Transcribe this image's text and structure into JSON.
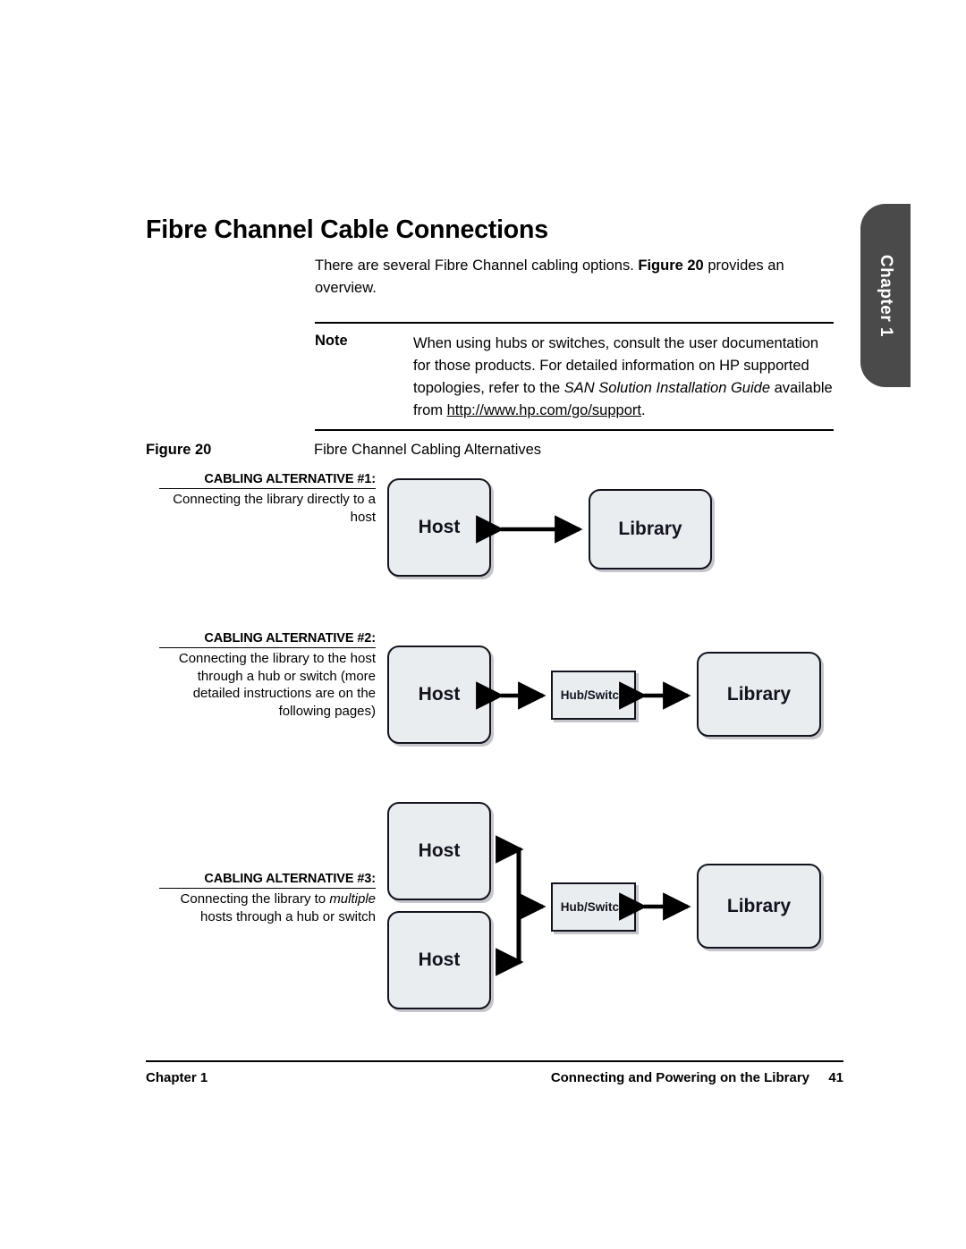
{
  "chapter_tab": {
    "label": "Chapter 1"
  },
  "heading": {
    "title": "Fibre Channel Cable Connections"
  },
  "intro": {
    "text_before": "There are several Fibre Channel cabling options. ",
    "bold_ref": "Figure 20",
    "text_after": " provides an overview."
  },
  "note": {
    "label": "Note",
    "line1": "When using hubs or switches, consult the user documentation for those products. For detailed information on HP supported topologies, refer to the ",
    "italic_title": "SAN Solution Installation Guide",
    "line2": " available from ",
    "url": "http://www.hp.com/go/support",
    "end": "."
  },
  "figure": {
    "number": "Figure 20",
    "title": "Fibre Channel Cabling Alternatives"
  },
  "alternatives": [
    {
      "title": "CABLING ALTERNATIVE #1:",
      "description": "Connecting the library directly to a host",
      "nodes": {
        "host": "Host",
        "library": "Library"
      }
    },
    {
      "title": "CABLING ALTERNATIVE #2:",
      "description": "Connecting the library to the host through a hub or switch (more detailed instructions are on the following pages)",
      "nodes": {
        "host": "Host",
        "hub": "Hub/Switch",
        "library": "Library"
      }
    },
    {
      "title": "CABLING ALTERNATIVE #3:",
      "description_pre": "Connecting the library to ",
      "description_italic": "multiple",
      "description_post": " hosts through a hub or switch",
      "nodes": {
        "host1": "Host",
        "host2": "Host",
        "hub": "Hub/Switch",
        "library": "Library"
      }
    }
  ],
  "footer": {
    "left": "Chapter 1",
    "center": "Connecting and Powering on the Library",
    "page_number": "41"
  },
  "colors": {
    "tab_background": "#4a4a4a",
    "node_fill": "#e9edf0",
    "node_border": "#13131e",
    "rule": "#000000"
  }
}
